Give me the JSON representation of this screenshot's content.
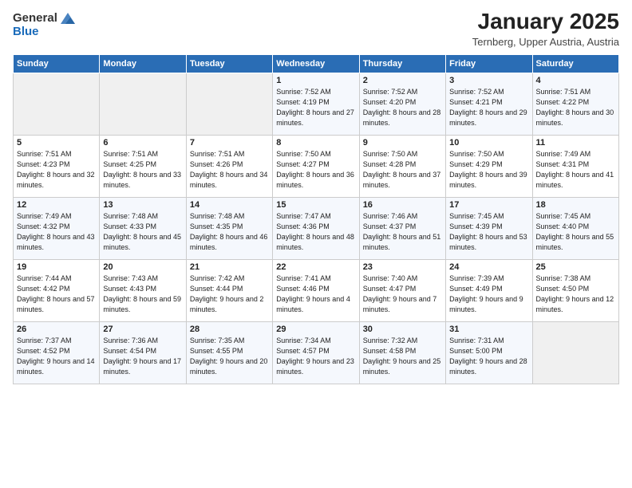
{
  "logo": {
    "general": "General",
    "blue": "Blue"
  },
  "header": {
    "month": "January 2025",
    "location": "Ternberg, Upper Austria, Austria"
  },
  "weekdays": [
    "Sunday",
    "Monday",
    "Tuesday",
    "Wednesday",
    "Thursday",
    "Friday",
    "Saturday"
  ],
  "weeks": [
    [
      {
        "day": "",
        "info": ""
      },
      {
        "day": "",
        "info": ""
      },
      {
        "day": "",
        "info": ""
      },
      {
        "day": "1",
        "info": "Sunrise: 7:52 AM\nSunset: 4:19 PM\nDaylight: 8 hours and 27 minutes."
      },
      {
        "day": "2",
        "info": "Sunrise: 7:52 AM\nSunset: 4:20 PM\nDaylight: 8 hours and 28 minutes."
      },
      {
        "day": "3",
        "info": "Sunrise: 7:52 AM\nSunset: 4:21 PM\nDaylight: 8 hours and 29 minutes."
      },
      {
        "day": "4",
        "info": "Sunrise: 7:51 AM\nSunset: 4:22 PM\nDaylight: 8 hours and 30 minutes."
      }
    ],
    [
      {
        "day": "5",
        "info": "Sunrise: 7:51 AM\nSunset: 4:23 PM\nDaylight: 8 hours and 32 minutes."
      },
      {
        "day": "6",
        "info": "Sunrise: 7:51 AM\nSunset: 4:25 PM\nDaylight: 8 hours and 33 minutes."
      },
      {
        "day": "7",
        "info": "Sunrise: 7:51 AM\nSunset: 4:26 PM\nDaylight: 8 hours and 34 minutes."
      },
      {
        "day": "8",
        "info": "Sunrise: 7:50 AM\nSunset: 4:27 PM\nDaylight: 8 hours and 36 minutes."
      },
      {
        "day": "9",
        "info": "Sunrise: 7:50 AM\nSunset: 4:28 PM\nDaylight: 8 hours and 37 minutes."
      },
      {
        "day": "10",
        "info": "Sunrise: 7:50 AM\nSunset: 4:29 PM\nDaylight: 8 hours and 39 minutes."
      },
      {
        "day": "11",
        "info": "Sunrise: 7:49 AM\nSunset: 4:31 PM\nDaylight: 8 hours and 41 minutes."
      }
    ],
    [
      {
        "day": "12",
        "info": "Sunrise: 7:49 AM\nSunset: 4:32 PM\nDaylight: 8 hours and 43 minutes."
      },
      {
        "day": "13",
        "info": "Sunrise: 7:48 AM\nSunset: 4:33 PM\nDaylight: 8 hours and 45 minutes."
      },
      {
        "day": "14",
        "info": "Sunrise: 7:48 AM\nSunset: 4:35 PM\nDaylight: 8 hours and 46 minutes."
      },
      {
        "day": "15",
        "info": "Sunrise: 7:47 AM\nSunset: 4:36 PM\nDaylight: 8 hours and 48 minutes."
      },
      {
        "day": "16",
        "info": "Sunrise: 7:46 AM\nSunset: 4:37 PM\nDaylight: 8 hours and 51 minutes."
      },
      {
        "day": "17",
        "info": "Sunrise: 7:45 AM\nSunset: 4:39 PM\nDaylight: 8 hours and 53 minutes."
      },
      {
        "day": "18",
        "info": "Sunrise: 7:45 AM\nSunset: 4:40 PM\nDaylight: 8 hours and 55 minutes."
      }
    ],
    [
      {
        "day": "19",
        "info": "Sunrise: 7:44 AM\nSunset: 4:42 PM\nDaylight: 8 hours and 57 minutes."
      },
      {
        "day": "20",
        "info": "Sunrise: 7:43 AM\nSunset: 4:43 PM\nDaylight: 8 hours and 59 minutes."
      },
      {
        "day": "21",
        "info": "Sunrise: 7:42 AM\nSunset: 4:44 PM\nDaylight: 9 hours and 2 minutes."
      },
      {
        "day": "22",
        "info": "Sunrise: 7:41 AM\nSunset: 4:46 PM\nDaylight: 9 hours and 4 minutes."
      },
      {
        "day": "23",
        "info": "Sunrise: 7:40 AM\nSunset: 4:47 PM\nDaylight: 9 hours and 7 minutes."
      },
      {
        "day": "24",
        "info": "Sunrise: 7:39 AM\nSunset: 4:49 PM\nDaylight: 9 hours and 9 minutes."
      },
      {
        "day": "25",
        "info": "Sunrise: 7:38 AM\nSunset: 4:50 PM\nDaylight: 9 hours and 12 minutes."
      }
    ],
    [
      {
        "day": "26",
        "info": "Sunrise: 7:37 AM\nSunset: 4:52 PM\nDaylight: 9 hours and 14 minutes."
      },
      {
        "day": "27",
        "info": "Sunrise: 7:36 AM\nSunset: 4:54 PM\nDaylight: 9 hours and 17 minutes."
      },
      {
        "day": "28",
        "info": "Sunrise: 7:35 AM\nSunset: 4:55 PM\nDaylight: 9 hours and 20 minutes."
      },
      {
        "day": "29",
        "info": "Sunrise: 7:34 AM\nSunset: 4:57 PM\nDaylight: 9 hours and 23 minutes."
      },
      {
        "day": "30",
        "info": "Sunrise: 7:32 AM\nSunset: 4:58 PM\nDaylight: 9 hours and 25 minutes."
      },
      {
        "day": "31",
        "info": "Sunrise: 7:31 AM\nSunset: 5:00 PM\nDaylight: 9 hours and 28 minutes."
      },
      {
        "day": "",
        "info": ""
      }
    ]
  ]
}
